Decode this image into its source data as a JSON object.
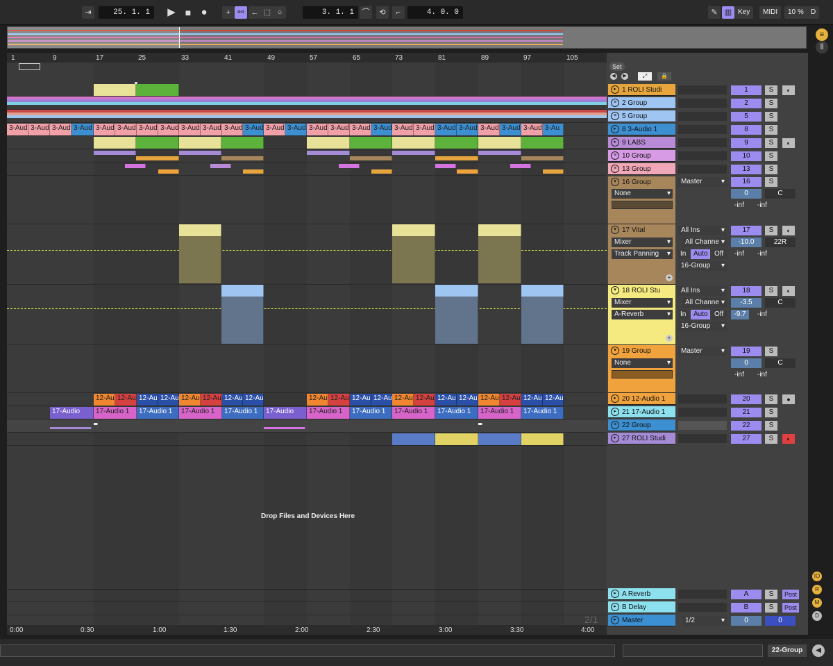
{
  "transport": {
    "position": "25. 1. 1",
    "loop_start": "3. 1. 1",
    "loop_length": "4. 0. 0",
    "key_label": "Key",
    "midi_label": "MIDI",
    "cpu_label": "10 %",
    "d_label": "D"
  },
  "ruler": {
    "bars": [
      "1",
      "9",
      "17",
      "25",
      "33",
      "41",
      "49",
      "57",
      "65",
      "73",
      "81",
      "89",
      "97",
      "105"
    ],
    "times": [
      "0:00",
      "0:30",
      "1:00",
      "1:30",
      "2:00",
      "2:30",
      "3:00",
      "3:30",
      "4:00"
    ]
  },
  "set_button": "Set",
  "drop_text": "Drop Files and Devices Here",
  "page_indicator": "2/1",
  "track_clips": {
    "audio3_label": "3-Aud",
    "audio3_label_b": "3-Au",
    "audio12_label": "12-Au",
    "audio17_label": "17-Audio 1",
    "audio17_short": "17-Audio"
  },
  "tracks": [
    {
      "name": "1 ROLI Studi",
      "number": "1",
      "color": "#e6a53d"
    },
    {
      "name": "2 Group",
      "number": "2",
      "color": "#9fc6f3"
    },
    {
      "name": "5 Group",
      "number": "5",
      "color": "#9fc6f3"
    },
    {
      "name": "8 3-Audio 1",
      "number": "8",
      "color": "#3c8fd1"
    },
    {
      "name": "9 LABS",
      "number": "9",
      "color": "#b98bd6"
    },
    {
      "name": "10 Group",
      "number": "10",
      "color": "#d69be4"
    },
    {
      "name": "13 Group",
      "number": "13",
      "color": "#f0a7b8"
    },
    {
      "name": "16 Group",
      "number": "16",
      "color": "#a8865c"
    },
    {
      "name": "17 Vital",
      "number": "17",
      "color": "#a8865c"
    },
    {
      "name": "18 ROLI Stu",
      "number": "18",
      "color": "#f5ea80"
    },
    {
      "name": "19 Group",
      "number": "19",
      "color": "#f0a23c"
    },
    {
      "name": "20 12-Audio 1",
      "number": "20",
      "color": "#f0a23c"
    },
    {
      "name": "21 17-Audio 1",
      "number": "21",
      "color": "#8de0ee"
    },
    {
      "name": "22 Group",
      "number": "22",
      "color": "#3c8fd1"
    },
    {
      "name": "27 ROLI Studi",
      "number": "27",
      "color": "#a58bd6"
    }
  ],
  "returns": [
    {
      "name": "A Reverb",
      "number": "A",
      "post": "Post",
      "color": "#8de0ee"
    },
    {
      "name": "B Delay",
      "number": "B",
      "post": "Post",
      "color": "#8de0ee"
    },
    {
      "name": "Master",
      "number": "0",
      "color": "#3c8fd1"
    }
  ],
  "io": {
    "master_label": "Master",
    "none_label": "None",
    "zero": "0",
    "c": "C",
    "inf": "-inf",
    "all_ins": "All Ins",
    "all_channels": "All Channe",
    "mixer": "Mixer",
    "track_panning": "Track Panning",
    "a_reverb": "A-Reverb",
    "in_label": "In",
    "auto_label": "Auto",
    "off_label": "Off",
    "group16": "16-Group",
    "vital_vol": "-10.0",
    "vital_pan": "22R",
    "roli_vol": "-3.5",
    "roli_vol2": "-9.7",
    "master_sel": "1/2",
    "master_vol": "0",
    "master_pan": "0",
    "s": "S"
  },
  "side_buttons": [
    "IO",
    "R",
    "M",
    "D"
  ],
  "status_right": "22-Group"
}
